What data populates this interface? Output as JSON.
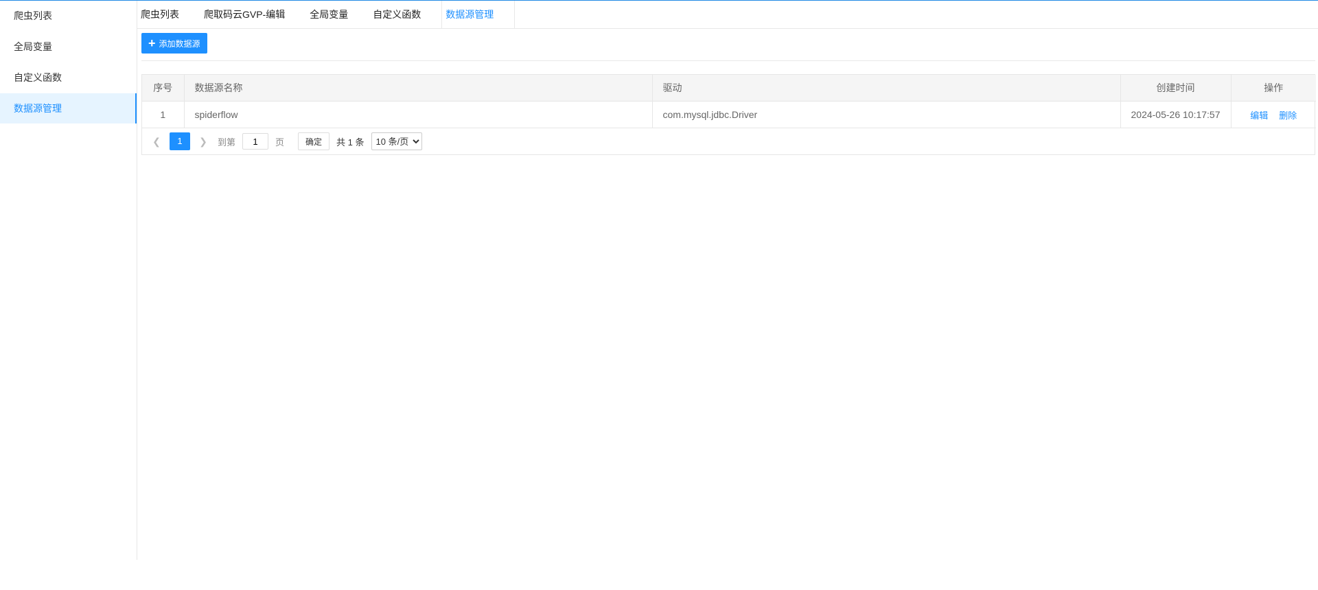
{
  "sidebar": {
    "items": [
      {
        "label": "爬虫列表"
      },
      {
        "label": "全局变量"
      },
      {
        "label": "自定义函数"
      },
      {
        "label": "数据源管理"
      }
    ]
  },
  "tabs": [
    {
      "label": "爬虫列表"
    },
    {
      "label": "爬取码云GVP-编辑"
    },
    {
      "label": "全局变量"
    },
    {
      "label": "自定义函数"
    },
    {
      "label": "数据源管理"
    }
  ],
  "toolbar": {
    "add_label": "添加数据源"
  },
  "table": {
    "headers": [
      "序号",
      "数据源名称",
      "驱动",
      "创建时间",
      "操作"
    ],
    "rows": [
      {
        "index": "1",
        "name": "spiderflow",
        "driver": "com.mysql.jdbc.Driver",
        "created": "2024-05-26 10:17:57",
        "edit": "编辑",
        "delete": "删除"
      }
    ]
  },
  "pager": {
    "current_page": "1",
    "goto_label": "到第",
    "goto_value": "1",
    "page_unit": "页",
    "confirm_label": "确定",
    "total_text": "共 1 条",
    "page_size": "10 条/页"
  },
  "colors": {
    "accent": "#1e90ff",
    "active_bg": "#e6f4ff",
    "header_bg": "#f5f5f5"
  }
}
